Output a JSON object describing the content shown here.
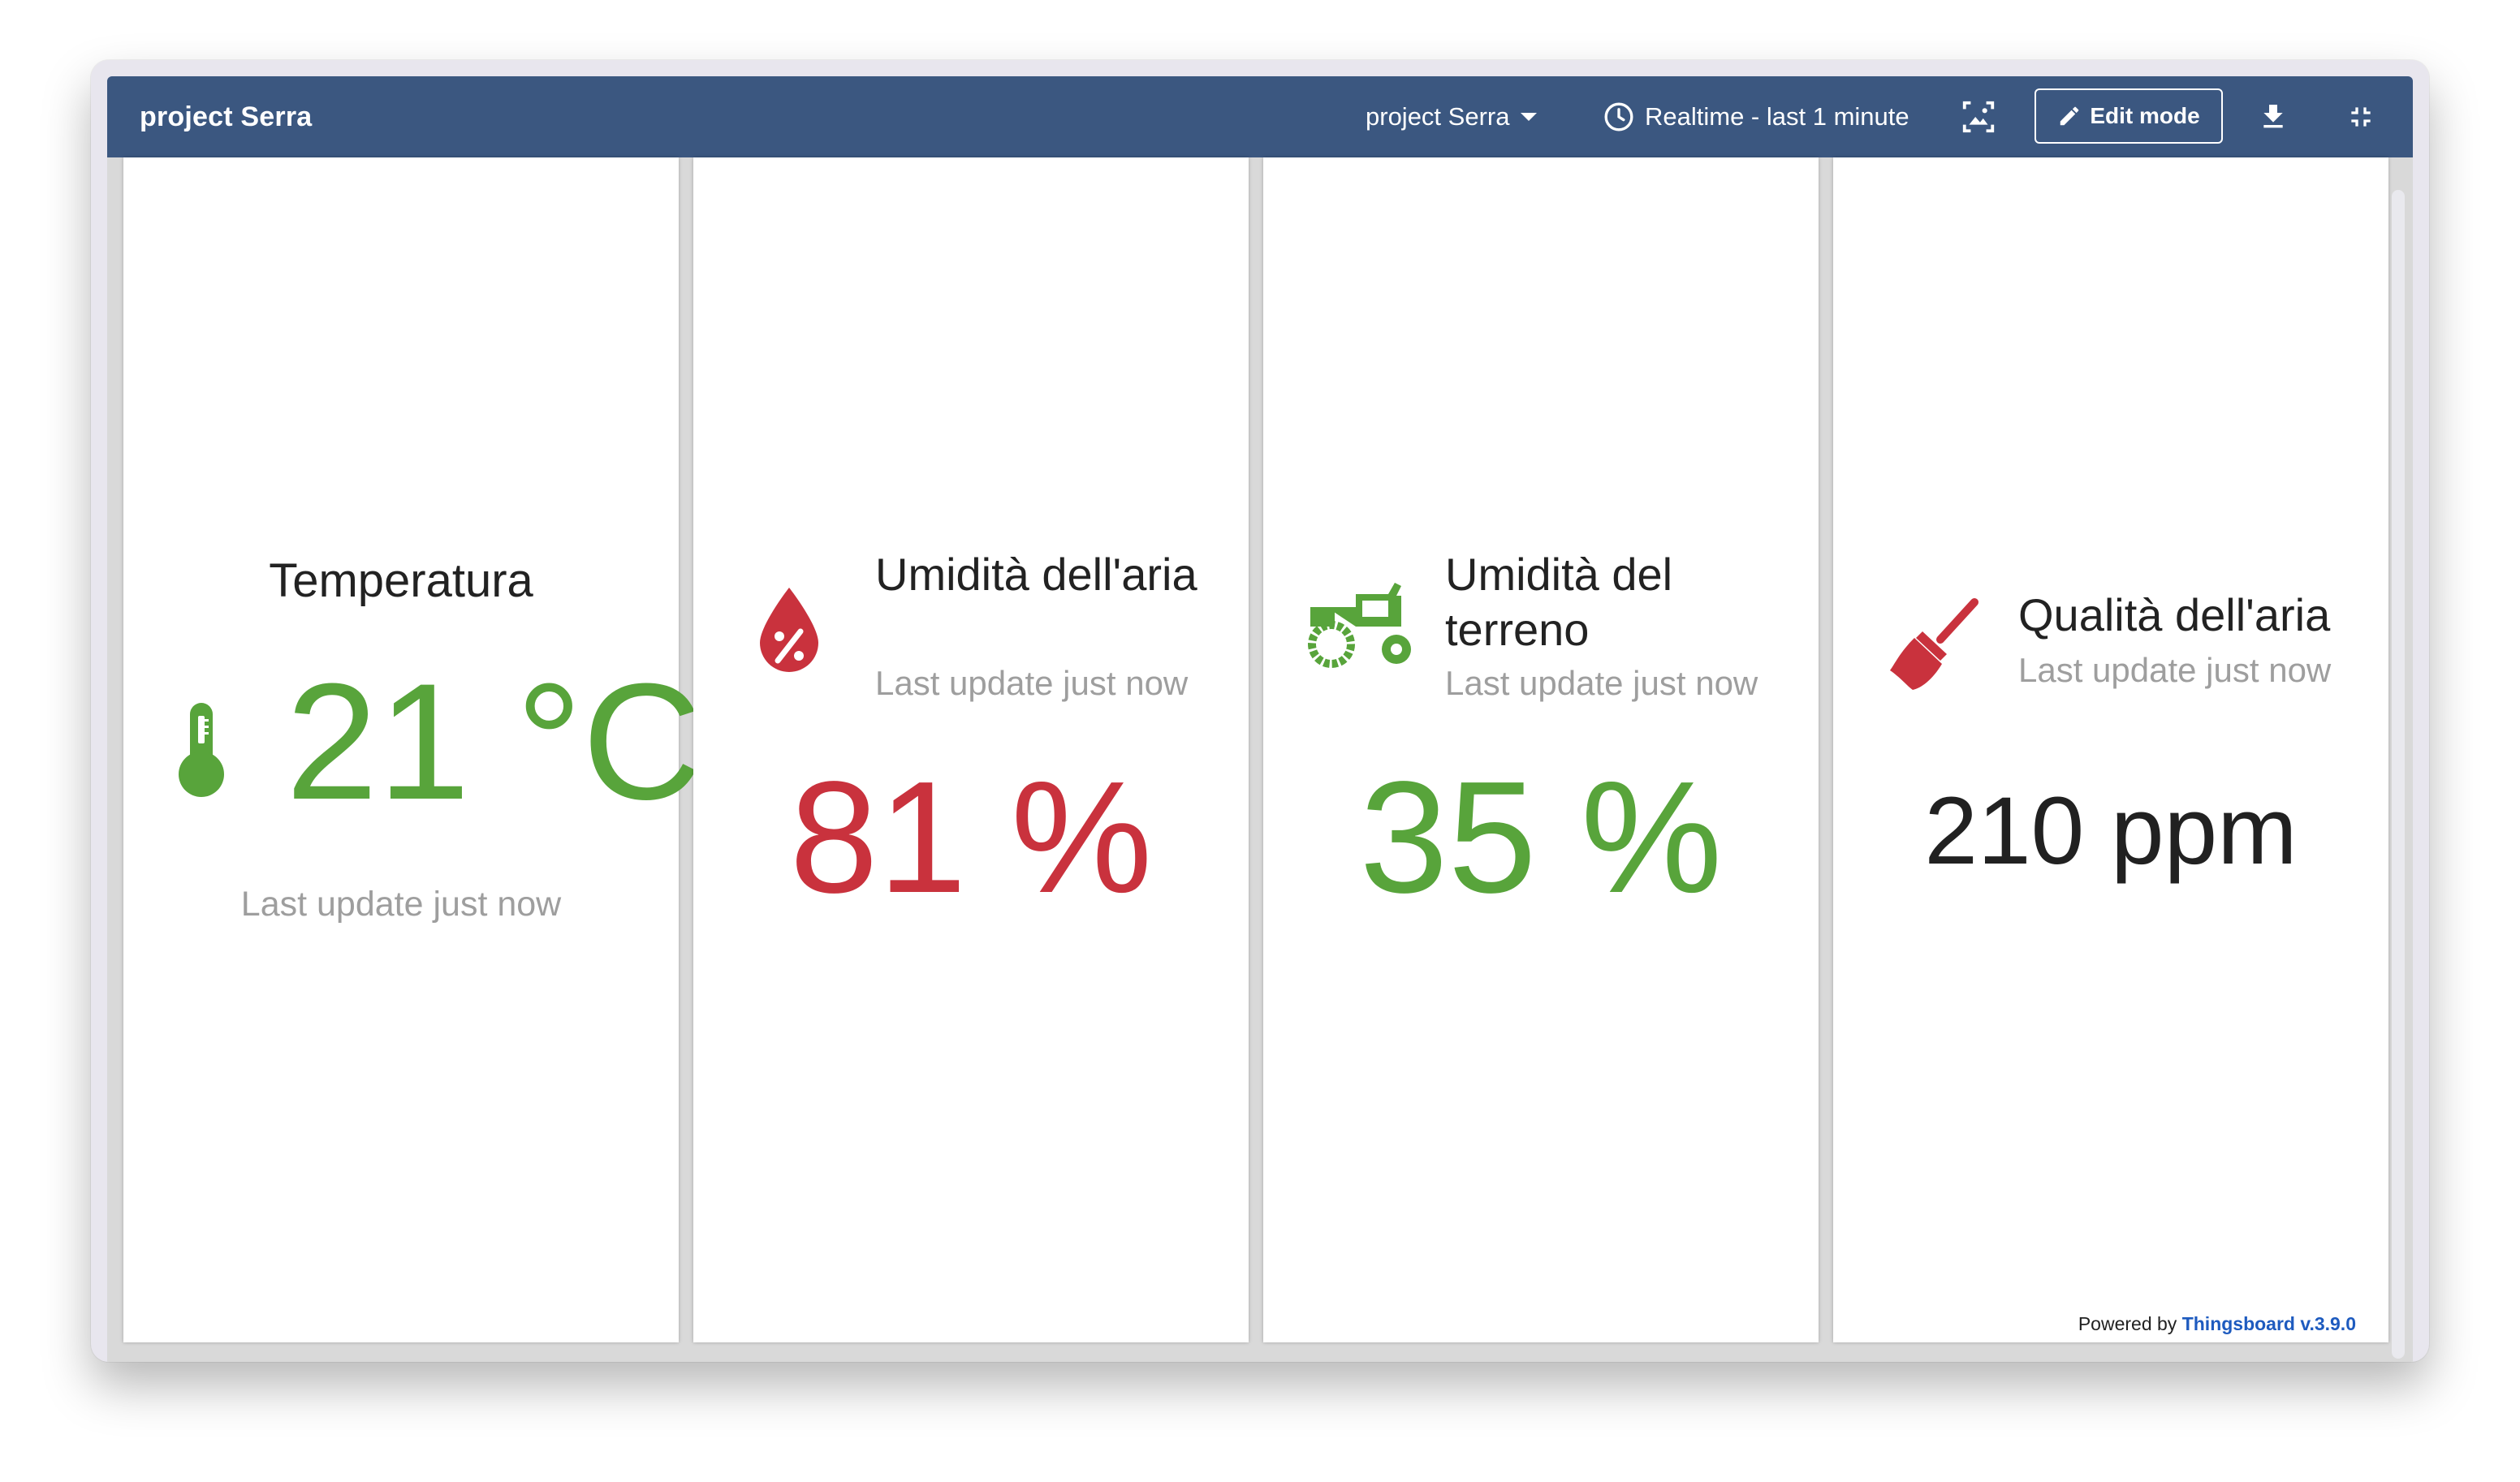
{
  "header": {
    "title": "project Serra",
    "dashboard_select": "project Serra",
    "timewindow": "Realtime - last 1 minute",
    "edit_label": "Edit mode"
  },
  "cards": [
    {
      "title": "Temperatura",
      "icon": "thermometer-icon",
      "value": "21 °C",
      "subtitle": "Last update just now",
      "color": "#58a43b"
    },
    {
      "title": "Umidità dell'aria",
      "icon": "humidity-drop-icon",
      "value": "81 %",
      "subtitle": "Last update just now",
      "color": "#c9323d"
    },
    {
      "title": "Umidità del terreno",
      "icon": "tractor-icon",
      "value": "35 %",
      "subtitle": "Last update just now",
      "color": "#58a43b"
    },
    {
      "title": "Qualità dell'aria",
      "icon": "broom-icon",
      "value": "210 ppm",
      "subtitle": "Last update just now",
      "color": "#c9323d"
    }
  ],
  "footer": {
    "powered_by": "Powered by",
    "brand": "Thingsboard v.3.9.0"
  },
  "colors": {
    "toolbar": "#3b5780",
    "good": "#58a43b",
    "alert": "#c9323d"
  }
}
